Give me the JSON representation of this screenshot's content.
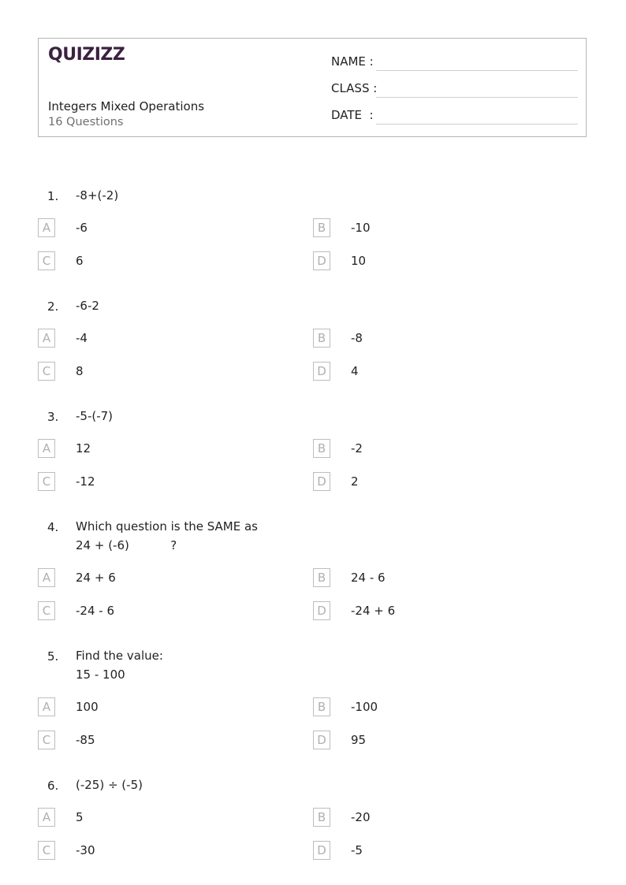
{
  "header": {
    "logo": "QUIZIZZ",
    "brand_color": "#3b2140",
    "title": "Integers Mixed Operations",
    "question_count": "16 Questions",
    "fields": [
      {
        "label": "NAME :"
      },
      {
        "label": "CLASS :"
      },
      {
        "label": "DATE  :"
      }
    ]
  },
  "questions": [
    {
      "number": "1.",
      "text": "-8+(-2)",
      "options": [
        {
          "letter": "A",
          "text": "-6"
        },
        {
          "letter": "B",
          "text": "-10"
        },
        {
          "letter": "C",
          "text": "6"
        },
        {
          "letter": "D",
          "text": "10"
        }
      ]
    },
    {
      "number": "2.",
      "text": "-6-2",
      "options": [
        {
          "letter": "A",
          "text": "-4"
        },
        {
          "letter": "B",
          "text": "-8"
        },
        {
          "letter": "C",
          "text": "8"
        },
        {
          "letter": "D",
          "text": "4"
        }
      ]
    },
    {
      "number": "3.",
      "text": "-5-(-7)",
      "options": [
        {
          "letter": "A",
          "text": "12"
        },
        {
          "letter": "B",
          "text": "-2"
        },
        {
          "letter": "C",
          "text": "-12"
        },
        {
          "letter": "D",
          "text": "2"
        }
      ]
    },
    {
      "number": "4.",
      "text": "Which question is the SAME as\n24 + (-6)           ?",
      "options": [
        {
          "letter": "A",
          "text": "24 + 6"
        },
        {
          "letter": "B",
          "text": "24 - 6"
        },
        {
          "letter": "C",
          "text": "-24 - 6"
        },
        {
          "letter": "D",
          "text": "-24 + 6"
        }
      ]
    },
    {
      "number": "5.",
      "text": "Find the value:\n15 - 100",
      "options": [
        {
          "letter": "A",
          "text": "100"
        },
        {
          "letter": "B",
          "text": "-100"
        },
        {
          "letter": "C",
          "text": "-85"
        },
        {
          "letter": "D",
          "text": "95"
        }
      ]
    },
    {
      "number": "6.",
      "text": "(-25) ÷ (-5)",
      "options": [
        {
          "letter": "A",
          "text": "5"
        },
        {
          "letter": "B",
          "text": "-20"
        },
        {
          "letter": "C",
          "text": "-30"
        },
        {
          "letter": "D",
          "text": "-5"
        }
      ]
    }
  ]
}
